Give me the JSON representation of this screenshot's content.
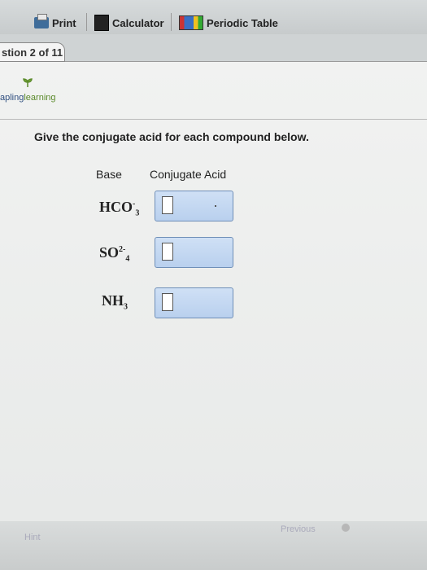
{
  "toolbar": {
    "print_label": "Print",
    "calculator_label": "Calculator",
    "periodic_table_label": "Periodic Table"
  },
  "question_tab": {
    "label": "stion 2 of 11"
  },
  "brand": {
    "left": "apling",
    "right": "learning"
  },
  "question": {
    "prompt": "Give the conjugate acid for each compound below.",
    "headers": [
      "Base",
      "Conjugate Acid"
    ],
    "rows": [
      {
        "base": "HCO",
        "sub": "3",
        "sup": "-"
      },
      {
        "base": "SO",
        "sub": "4",
        "sup": "2-"
      },
      {
        "base": "NH",
        "sub": "3",
        "sup": ""
      }
    ]
  },
  "footer": {
    "hint": "Hint",
    "previous": "Previous"
  },
  "colors": {
    "input_bg": "#c6dbf2",
    "input_border": "#6f8fb8",
    "brand_green": "#5a8a2a"
  }
}
